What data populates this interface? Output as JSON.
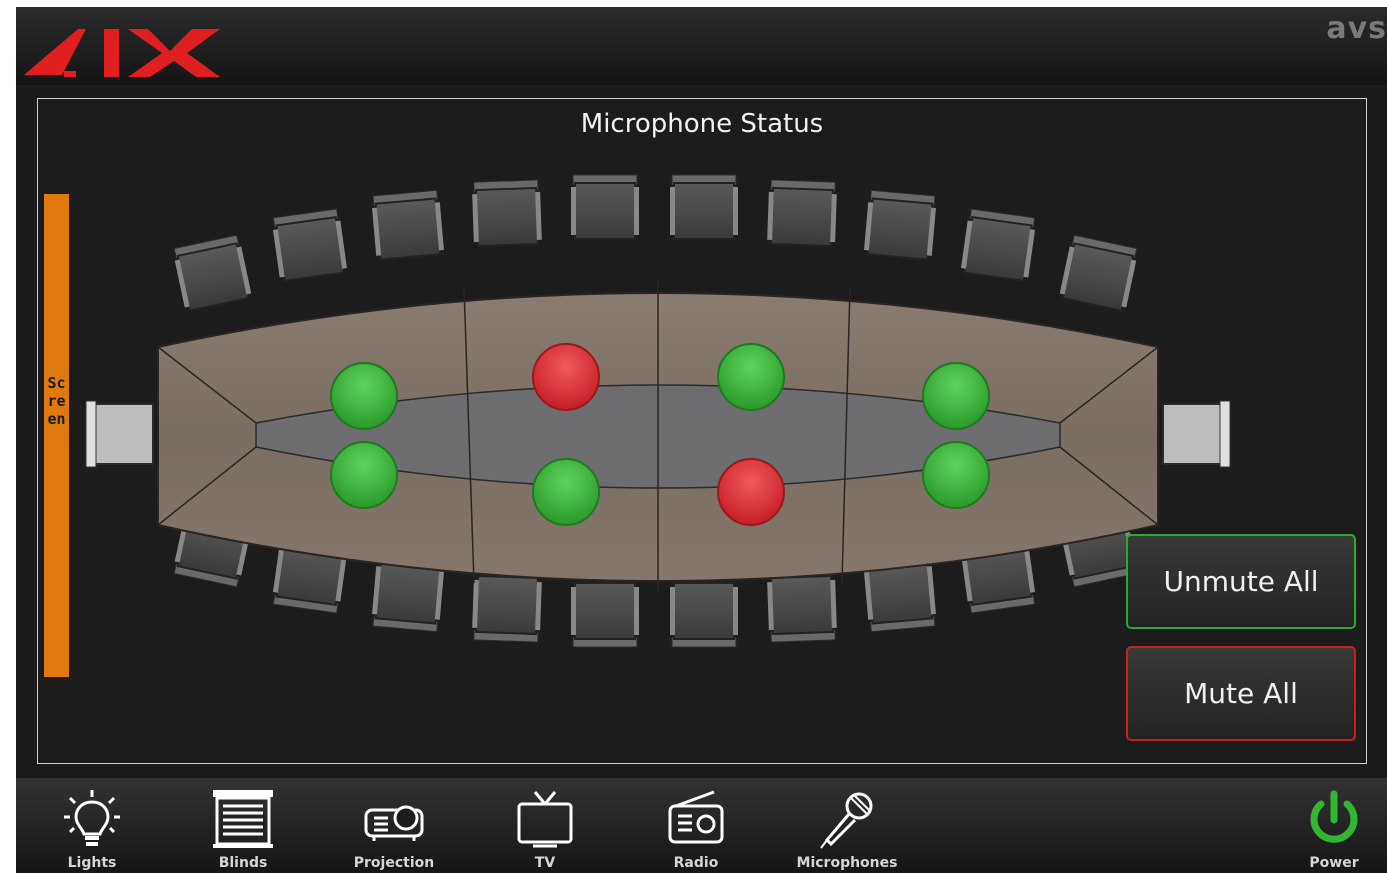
{
  "brand": "avs",
  "panel": {
    "title": "Microphone Status",
    "screen_label": "Screen"
  },
  "microphones": [
    {
      "id": 1,
      "status": "unmuted"
    },
    {
      "id": 2,
      "status": "unmuted"
    },
    {
      "id": 3,
      "status": "muted"
    },
    {
      "id": 4,
      "status": "unmuted"
    },
    {
      "id": 5,
      "status": "unmuted"
    },
    {
      "id": 6,
      "status": "muted"
    },
    {
      "id": 7,
      "status": "unmuted"
    },
    {
      "id": 8,
      "status": "unmuted"
    }
  ],
  "actions": {
    "unmute_all": "Unmute All",
    "mute_all": "Mute All"
  },
  "nav": {
    "lights": "Lights",
    "blinds": "Blinds",
    "projection": "Projection",
    "tv": "TV",
    "radio": "Radio",
    "microphones": "Microphones",
    "power": "Power"
  },
  "colors": {
    "logo_red": "#e02020",
    "screen_orange": "#e07a0f",
    "unmuted_green": "#3cb83c",
    "muted_red": "#e0303a",
    "power_green": "#2fb82f"
  }
}
